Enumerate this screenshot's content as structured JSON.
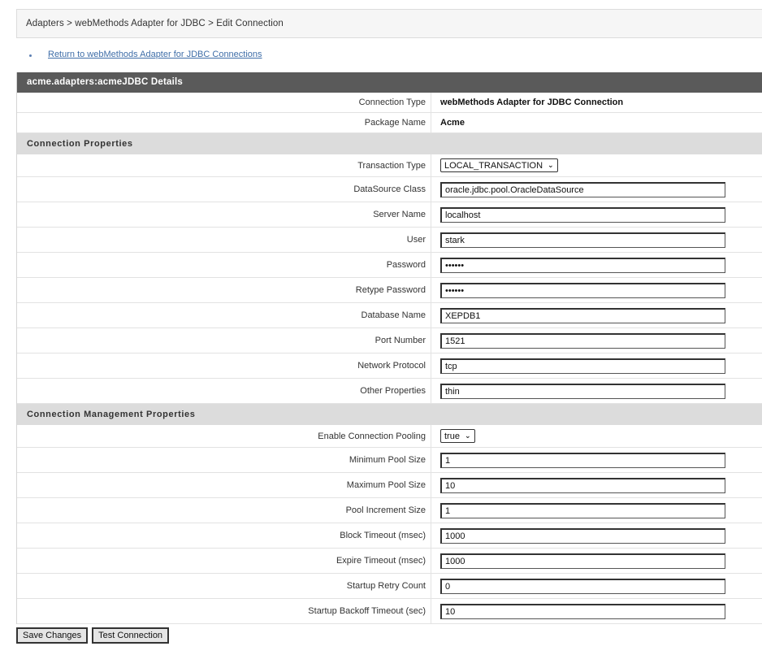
{
  "breadcrumb": "Adapters > webMethods Adapter for JDBC > Edit Connection",
  "return_link": "Return to webMethods Adapter for JDBC Connections",
  "panel_title": "acme.adapters:acmeJDBC Details",
  "details": [
    {
      "label": "Connection Type",
      "value": "webMethods Adapter for JDBC Connection"
    },
    {
      "label": "Package Name",
      "value": "Acme"
    }
  ],
  "connection_properties": {
    "title": "Connection Properties",
    "transaction_type": {
      "label": "Transaction Type",
      "value": "LOCAL_TRANSACTION"
    },
    "fields": [
      {
        "label": "DataSource Class",
        "value": "oracle.jdbc.pool.OracleDataSource"
      },
      {
        "label": "Server Name",
        "value": "localhost"
      },
      {
        "label": "User",
        "value": "stark"
      },
      {
        "label": "Password",
        "value": "••••••"
      },
      {
        "label": "Retype Password",
        "value": "••••••"
      },
      {
        "label": "Database Name",
        "value": "XEPDB1"
      },
      {
        "label": "Port Number",
        "value": "1521"
      },
      {
        "label": "Network Protocol",
        "value": "tcp"
      },
      {
        "label": "Other Properties",
        "value": "thin"
      }
    ]
  },
  "management_properties": {
    "title": "Connection Management Properties",
    "pooling": {
      "label": "Enable Connection Pooling",
      "value": "true"
    },
    "fields": [
      {
        "label": "Minimum Pool Size",
        "value": "1"
      },
      {
        "label": "Maximum Pool Size",
        "value": "10"
      },
      {
        "label": "Pool Increment Size",
        "value": "1"
      },
      {
        "label": "Block Timeout (msec)",
        "value": "1000"
      },
      {
        "label": "Expire Timeout (msec)",
        "value": "1000"
      },
      {
        "label": "Startup Retry Count",
        "value": "0"
      },
      {
        "label": "Startup Backoff Timeout (sec)",
        "value": "10"
      }
    ]
  },
  "buttons": {
    "save": "Save Changes",
    "test": "Test Connection"
  },
  "icons": {
    "select_chevron": "chevron-down-icon",
    "bullet": "bullet-icon"
  },
  "colors": {
    "header_bg": "#5a5a5a",
    "section_bg": "#dcdcdc",
    "link": "#3f6ea8"
  }
}
